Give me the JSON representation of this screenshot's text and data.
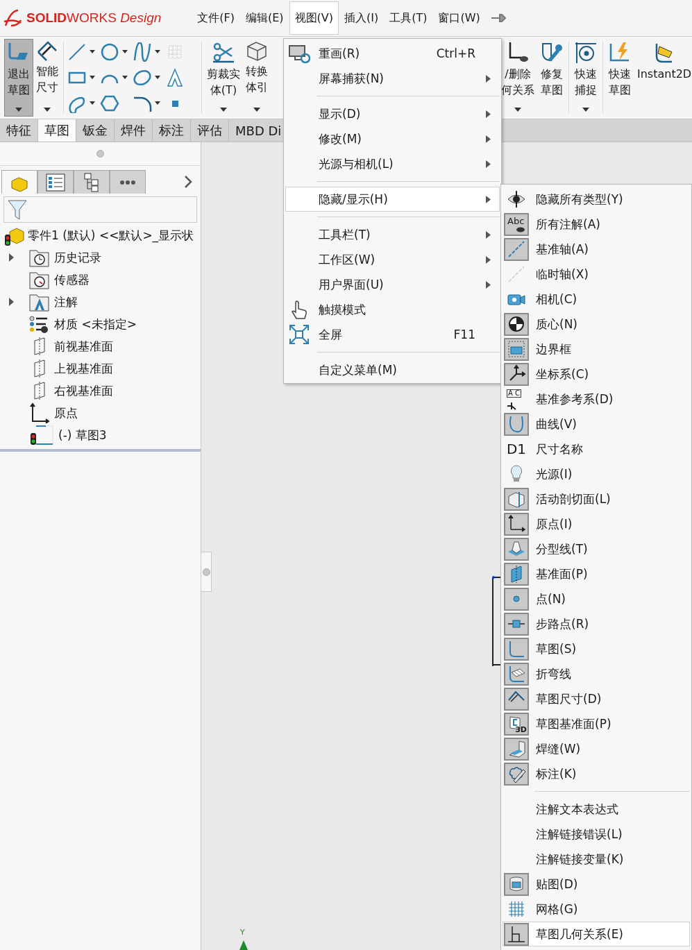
{
  "logo": "**SOLID**WORKS *Design*",
  "menubar": [
    {
      "label": "文件(F)",
      "selected": false
    },
    {
      "label": "编辑(E)",
      "selected": false
    },
    {
      "label": "视图(V)",
      "selected": true
    },
    {
      "label": "插入(I)",
      "selected": false
    },
    {
      "label": "工具(T)",
      "selected": false
    },
    {
      "label": "窗口(W)",
      "selected": false
    }
  ],
  "ribbon": [
    {
      "lines": [
        "退出",
        "草图"
      ],
      "selected": true,
      "caret": true
    },
    {
      "lines": [
        "智能",
        "尺寸"
      ],
      "selected": false,
      "caret": true
    },
    {
      "kind": "grid"
    },
    {
      "lines": [
        "剪裁实",
        "体(T)"
      ],
      "selected": false,
      "caret": true
    },
    {
      "lines": [
        "转换",
        "体引"
      ],
      "selected": false,
      "caret": true
    },
    {
      "lines": [
        "/删除",
        "何关系"
      ],
      "selected": false,
      "caret": true
    },
    {
      "lines": [
        "修复",
        "草图"
      ],
      "selected": false,
      "caret": false
    },
    {
      "lines": [
        "快速",
        "捕捉"
      ],
      "selected": false,
      "caret": true
    },
    {
      "lines": [
        "快速",
        "草图"
      ],
      "selected": false,
      "caret": false
    },
    {
      "lines": [
        "Instant2D"
      ],
      "selected": false,
      "caret": false
    }
  ],
  "tabs": [
    {
      "label": "特征",
      "selected": false
    },
    {
      "label": "草图",
      "selected": true
    },
    {
      "label": "钣金",
      "selected": false
    },
    {
      "label": "焊件",
      "selected": false
    },
    {
      "label": "标注",
      "selected": false
    },
    {
      "label": "评估",
      "selected": false
    },
    {
      "label": "MBD Di",
      "selected": false
    }
  ],
  "panel_tabs": [
    {
      "selected": true
    },
    {
      "selected": false
    },
    {
      "selected": false
    },
    {
      "selected": false
    }
  ],
  "tree": {
    "label": "零件1 (默认) <<默认>_显示状",
    "children": [
      {
        "label": "历史记录",
        "collapsed": true
      },
      {
        "label": "传感器",
        "collapsed": false
      },
      {
        "label": "注解",
        "collapsed": true
      },
      {
        "label": "材质 <未指定>",
        "collapsed": false
      },
      {
        "label": "前视基准面",
        "collapsed": false
      },
      {
        "label": "上视基准面",
        "collapsed": false
      },
      {
        "label": "右视基准面",
        "collapsed": false
      },
      {
        "label": "原点",
        "collapsed": false
      },
      {
        "label": "(-) 草图3",
        "collapsed": false
      }
    ]
  },
  "canvas": {
    "axis_label": "Y"
  },
  "view_menu": [
    {
      "kind": "item",
      "label": "重画(R)",
      "shortcut": "Ctrl+R",
      "submenu": false,
      "selected": false
    },
    {
      "kind": "item",
      "label": "屏幕捕获(N)",
      "submenu": true,
      "selected": false
    },
    {
      "kind": "separator"
    },
    {
      "kind": "item",
      "label": "显示(D)",
      "submenu": true,
      "selected": false
    },
    {
      "kind": "item",
      "label": "修改(M)",
      "submenu": true,
      "selected": false
    },
    {
      "kind": "item",
      "label": "光源与相机(L)",
      "submenu": true,
      "selected": false
    },
    {
      "kind": "separator"
    },
    {
      "kind": "item",
      "label": "隐藏/显示(H)",
      "submenu": true,
      "selected": true
    },
    {
      "kind": "separator"
    },
    {
      "kind": "item",
      "label": "工具栏(T)",
      "submenu": true,
      "selected": false
    },
    {
      "kind": "item",
      "label": "工作区(W)",
      "submenu": true,
      "selected": false
    },
    {
      "kind": "item",
      "label": "用户界面(U)",
      "submenu": true,
      "selected": false
    },
    {
      "kind": "item",
      "label": "触摸模式",
      "submenu": false,
      "selected": false
    },
    {
      "kind": "item",
      "label": "全屏",
      "shortcut": "F11",
      "submenu": false,
      "selected": false
    },
    {
      "kind": "separator"
    },
    {
      "kind": "item",
      "label": "自定义菜单(M)",
      "submenu": false,
      "selected": false
    }
  ],
  "hide_show_menu": [
    {
      "kind": "item",
      "label": "隐藏所有类型(Y)",
      "shown": false,
      "selected": false
    },
    {
      "kind": "item",
      "label": "所有注解(A)",
      "shown": true,
      "selected": false,
      "glyph": "Abc"
    },
    {
      "kind": "item",
      "label": "基准轴(A)",
      "shown": true,
      "selected": false
    },
    {
      "kind": "item",
      "label": "临时轴(X)",
      "shown": false,
      "selected": false
    },
    {
      "kind": "item",
      "label": "相机(C)",
      "shown": false,
      "selected": false
    },
    {
      "kind": "item",
      "label": "质心(N)",
      "shown": true,
      "selected": false
    },
    {
      "kind": "item",
      "label": "边界框",
      "shown": true,
      "selected": false
    },
    {
      "kind": "item",
      "label": "坐标系(C)",
      "shown": true,
      "selected": false
    },
    {
      "kind": "item",
      "label": "基准参考系(D)",
      "shown": false,
      "selected": false,
      "glyph": "A C"
    },
    {
      "kind": "item",
      "label": "曲线(V)",
      "shown": true,
      "selected": false
    },
    {
      "kind": "item",
      "label": "尺寸名称",
      "shown": false,
      "selected": false,
      "glyph": "D1"
    },
    {
      "kind": "item",
      "label": "光源(I)",
      "shown": false,
      "selected": false
    },
    {
      "kind": "item",
      "label": "活动剖切面(L)",
      "shown": true,
      "selected": false
    },
    {
      "kind": "item",
      "label": "原点(I)",
      "shown": true,
      "selected": false
    },
    {
      "kind": "item",
      "label": "分型线(T)",
      "shown": true,
      "selected": false
    },
    {
      "kind": "item",
      "label": "基准面(P)",
      "shown": true,
      "selected": false
    },
    {
      "kind": "item",
      "label": "点(N)",
      "shown": true,
      "selected": false
    },
    {
      "kind": "item",
      "label": "步路点(R)",
      "shown": true,
      "selected": false
    },
    {
      "kind": "item",
      "label": "草图(S)",
      "shown": true,
      "selected": false
    },
    {
      "kind": "item",
      "label": "折弯线",
      "shown": true,
      "selected": false
    },
    {
      "kind": "item",
      "label": "草图尺寸(D)",
      "shown": true,
      "selected": false
    },
    {
      "kind": "item",
      "label": "草图基准面(P)",
      "shown": true,
      "selected": false,
      "glyph": "3D"
    },
    {
      "kind": "item",
      "label": "焊缝(W)",
      "shown": true,
      "selected": false
    },
    {
      "kind": "item",
      "label": "标注(K)",
      "shown": true,
      "selected": false
    },
    {
      "kind": "separator"
    },
    {
      "kind": "item",
      "label": "注解文本表达式",
      "selected": false
    },
    {
      "kind": "item",
      "label": "注解链接错误(L)",
      "selected": false
    },
    {
      "kind": "item",
      "label": "注解链接变量(K)",
      "selected": false
    },
    {
      "kind": "item",
      "label": "贴图(D)",
      "shown": true,
      "selected": false
    },
    {
      "kind": "item",
      "label": "网格(G)",
      "shown": false,
      "selected": false
    },
    {
      "kind": "item",
      "label": "草图几何关系(E)",
      "shown": true,
      "selected": true
    }
  ]
}
